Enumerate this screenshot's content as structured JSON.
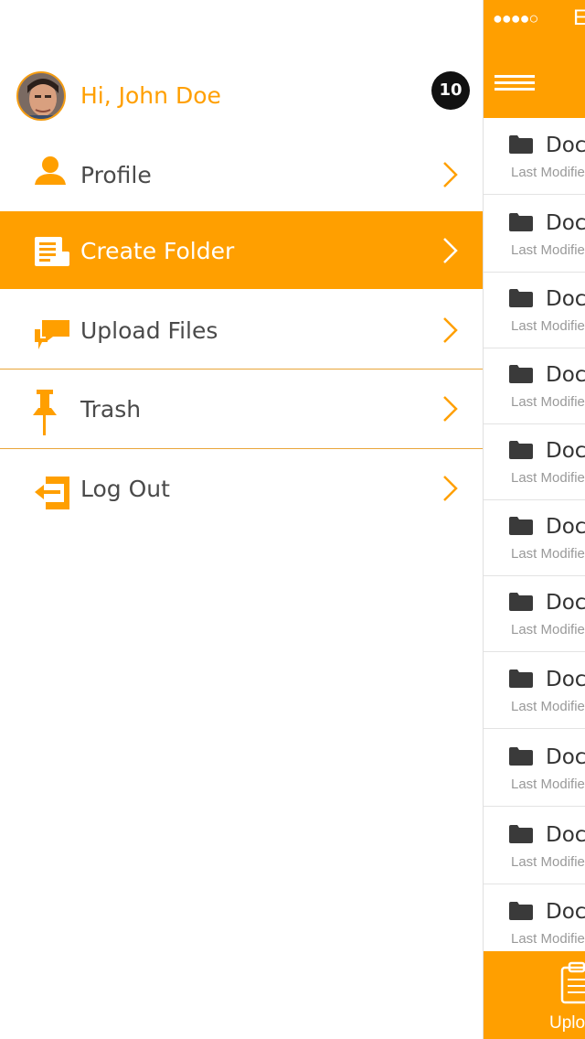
{
  "drawer": {
    "greeting": "Hi, John Doe",
    "notification_count": "10",
    "menu": [
      {
        "label": "Profile",
        "icon": "user-icon"
      },
      {
        "label": "Create Folder",
        "icon": "newspaper-icon",
        "active": true
      },
      {
        "label": "Upload Files",
        "icon": "chat-icon"
      },
      {
        "label": "Trash",
        "icon": "pin-icon"
      },
      {
        "label": "Log Out",
        "icon": "logout-icon"
      }
    ]
  },
  "list": {
    "signal": "●●●●○",
    "carrier": "E",
    "rows": [
      {
        "name": "Doc",
        "meta": "Last Modifie"
      },
      {
        "name": "Docu",
        "meta": "Last Modifie"
      },
      {
        "name": "Doc",
        "meta": "Last Modifie"
      },
      {
        "name": "Doc",
        "meta": "Last Modifie"
      },
      {
        "name": "Doc",
        "meta": "Last Modifie"
      },
      {
        "name": "Docu",
        "meta": "Last Modifie"
      },
      {
        "name": "Doc",
        "meta": "Last Modifie"
      },
      {
        "name": "Docu",
        "meta": "Last Modifie"
      },
      {
        "name": "Docu",
        "meta": "Last Modifie"
      },
      {
        "name": "Doc",
        "meta": "Last Modifie"
      },
      {
        "name": "Doc",
        "meta": "Last Modifie"
      }
    ],
    "bottom_label": "Uplo"
  },
  "colors": {
    "accent": "#ff9f00",
    "text": "#4a4a4a",
    "badge": "#111111"
  }
}
